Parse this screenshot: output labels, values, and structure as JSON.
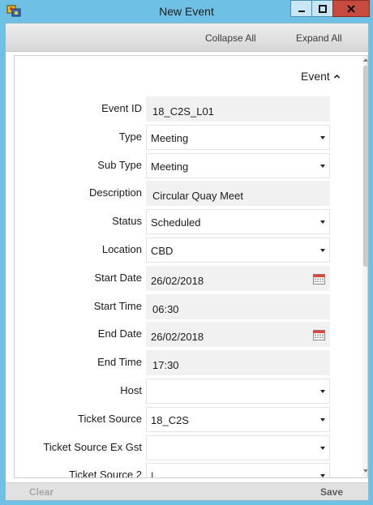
{
  "window": {
    "title": "New Event",
    "controls": {
      "minimize": "minimize",
      "maximize": "maximize",
      "close": "close"
    }
  },
  "toolbar": {
    "collapse_all": "Collapse All",
    "expand_all": "Expand All"
  },
  "section": {
    "title": "Event",
    "expanded": true
  },
  "fields": [
    {
      "label": "Event ID",
      "value": "18_C2S_L01",
      "kind": "text"
    },
    {
      "label": "Type",
      "value": "Meeting",
      "kind": "select"
    },
    {
      "label": "Sub Type",
      "value": "Meeting",
      "kind": "select"
    },
    {
      "label": "Description",
      "value": "Circular Quay Meet",
      "kind": "text"
    },
    {
      "label": "Status",
      "value": "Scheduled",
      "kind": "select"
    },
    {
      "label": "Location",
      "value": "CBD",
      "kind": "select"
    },
    {
      "label": "Start Date",
      "value": "26/02/2018",
      "kind": "date"
    },
    {
      "label": "Start Time",
      "value": "06:30",
      "kind": "text"
    },
    {
      "label": "End Date",
      "value": "26/02/2018",
      "kind": "date"
    },
    {
      "label": "End Time",
      "value": "17:30",
      "kind": "text"
    },
    {
      "label": "Host",
      "value": "",
      "kind": "select"
    },
    {
      "label": "Ticket Source",
      "value": "18_C2S",
      "kind": "select"
    },
    {
      "label": "Ticket Source Ex Gst",
      "value": "",
      "kind": "select"
    },
    {
      "label": "Ticket Source 2",
      "value": "|",
      "kind": "select"
    }
  ],
  "footer": {
    "clear": "Clear",
    "save": "Save"
  },
  "colors": {
    "titlebar": "#6ec1e4",
    "close_button": "#c74a3f",
    "field_bg": "#f1f1f1"
  },
  "icons": {
    "app": "app-icon",
    "calendar": "calendar-icon",
    "chevron_up": "chevron-up-icon",
    "dropdown": "dropdown-caret-icon"
  }
}
